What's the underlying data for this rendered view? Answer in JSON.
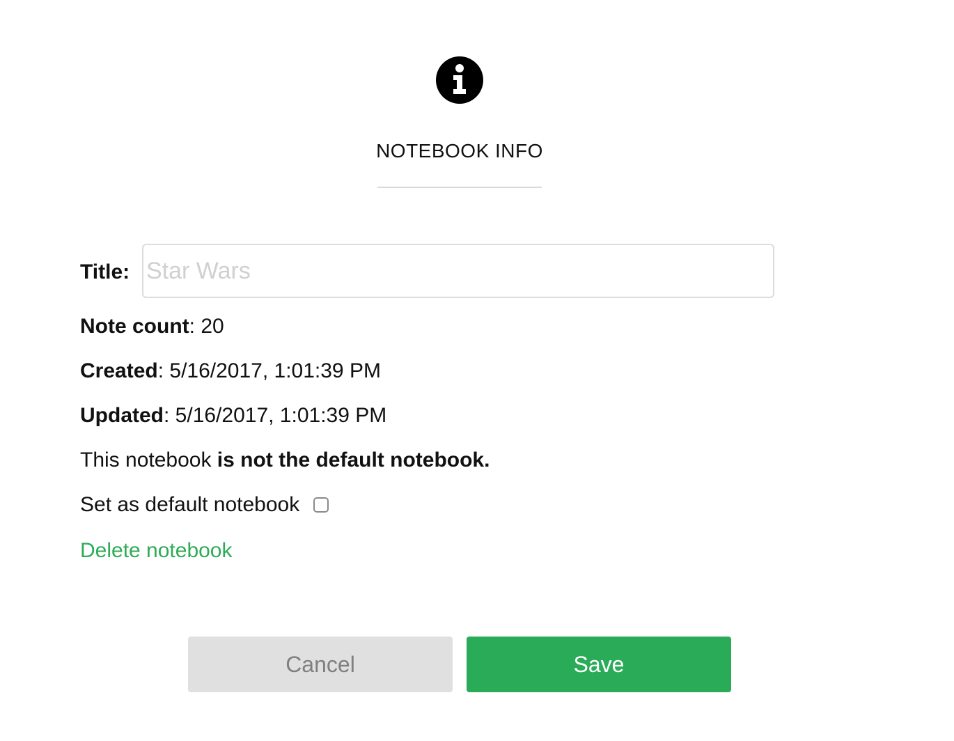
{
  "header": {
    "icon": "info-icon",
    "title": "NOTEBOOK INFO"
  },
  "form": {
    "title_label": "Title:",
    "title_value": "",
    "title_placeholder": "Star Wars",
    "note_count_label": "Note count",
    "note_count_value": ": 20",
    "created_label": "Created",
    "created_value": ": 5/16/2017, 1:01:39 PM",
    "updated_label": "Updated",
    "updated_value": ": 5/16/2017, 1:01:39 PM",
    "default_status_prefix": "This notebook ",
    "default_status_bold": "is not the default notebook.",
    "set_default_label": "Set as default notebook",
    "set_default_checked": false,
    "delete_label": "Delete notebook"
  },
  "buttons": {
    "cancel_label": "Cancel",
    "save_label": "Save"
  },
  "colors": {
    "accent_green": "#2aab58",
    "link_green": "#2dab57",
    "cancel_bg": "#e0e0e0"
  }
}
